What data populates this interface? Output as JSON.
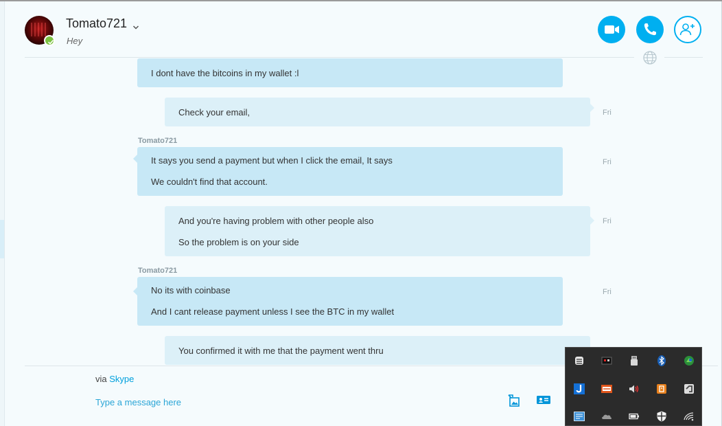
{
  "contact": {
    "name": "Tomato721",
    "mood": "Hey",
    "status": "online"
  },
  "header": {
    "video_call_icon": "video-camera",
    "audio_call_icon": "phone",
    "add_people_icon": "add-person",
    "translate_icon": "globe"
  },
  "messages": [
    {
      "direction": "incoming",
      "sender": "",
      "lines": [
        "I dont have the bitcoins in my wallet :l"
      ],
      "time": ""
    },
    {
      "direction": "outgoing",
      "sender": "",
      "lines": [
        "Check your email,"
      ],
      "time": "Fri"
    },
    {
      "direction": "incoming",
      "sender": "Tomato721",
      "lines": [
        "It says you send a payment but when I click the email, It says",
        "We couldn't find that account."
      ],
      "time": "Fri"
    },
    {
      "direction": "outgoing",
      "sender": "",
      "lines": [
        "And you're having problem with other people also",
        "So the problem is on your side"
      ],
      "time": "Fri"
    },
    {
      "direction": "incoming",
      "sender": "Tomato721",
      "lines": [
        "No its with coinbase",
        "And I cant release payment unless I see the BTC in my wallet"
      ],
      "time": "Fri"
    },
    {
      "direction": "outgoing",
      "sender": "",
      "lines": [
        "You confirmed it with me that the payment went thru"
      ],
      "time": ""
    }
  ],
  "footer": {
    "via_prefix": "via",
    "via_link": "Skype",
    "input_placeholder": "Type a message here",
    "send_media_icon": "image-send",
    "send_contact_icon": "contact-card"
  },
  "tray_icons": [
    "stack-app-icon",
    "terminal-app-icon",
    "usb-drive-icon",
    "bluetooth-icon",
    "green-app-icon",
    "blue-j-app-icon",
    "ccv-app-icon",
    "volume-icon",
    "orange-app-icon",
    "grey-app-icon",
    "monitor-app-icon",
    "onedrive-cloud-icon",
    "battery-icon",
    "shield-icon",
    "wifi-icon"
  ],
  "colors": {
    "accent": "#00aff0",
    "incoming_bubble": "#c7e8f6",
    "outgoing_bubble": "#dcf0f8",
    "presence": "#7cc242",
    "tray_bg": "#2b2b2b"
  }
}
